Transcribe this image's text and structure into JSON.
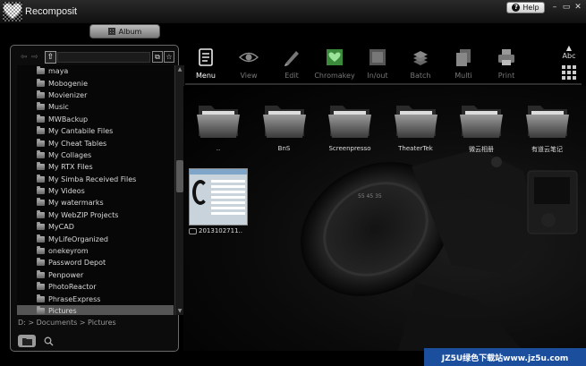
{
  "app": {
    "title": "Recomposit"
  },
  "titlebar": {
    "help_label": "Help",
    "minimize": "–",
    "restore": "▭",
    "close": "✕"
  },
  "album_tab": {
    "label": "Album"
  },
  "folder_tree": {
    "items": [
      "maya",
      "Mobogenie",
      "Movienizer",
      "Music",
      "MWBackup",
      "My Cantabile Files",
      "My Cheat Tables",
      "My Collages",
      "My RTX Files",
      "My Simba Received Files",
      "My Videos",
      "My watermarks",
      "My WebZIP Projects",
      "MyCAD",
      "MyLifeOrganized",
      "onekeyrom",
      "Password Depot",
      "Penpower",
      "PhotoReactor",
      "PhraseExpress",
      "Pictures"
    ],
    "selected_index": 20,
    "current_path": "D: > Documents > Pictures"
  },
  "toolbar": {
    "tools": [
      {
        "label": "Menu",
        "icon": "menu-icon",
        "active": true
      },
      {
        "label": "View",
        "icon": "eye-icon",
        "active": false
      },
      {
        "label": "Edit",
        "icon": "edit-icon",
        "active": false
      },
      {
        "label": "Chromakey",
        "icon": "chromakey-icon",
        "active": false
      },
      {
        "label": "In/out",
        "icon": "inout-icon",
        "active": false
      },
      {
        "label": "Batch",
        "icon": "batch-icon",
        "active": false
      },
      {
        "label": "Multi",
        "icon": "multi-icon",
        "active": false
      },
      {
        "label": "Print",
        "icon": "print-icon",
        "active": false
      }
    ],
    "sort_label": "Abc"
  },
  "content": {
    "folders": [
      "..",
      "BnS",
      "Screenpresso",
      "TheaterTek",
      "微云相册",
      "有道云笔记"
    ],
    "files": [
      {
        "name": "2013102711.."
      }
    ]
  },
  "watermark": {
    "text": "JZ5U绿色下载站www.jz5u.com"
  }
}
